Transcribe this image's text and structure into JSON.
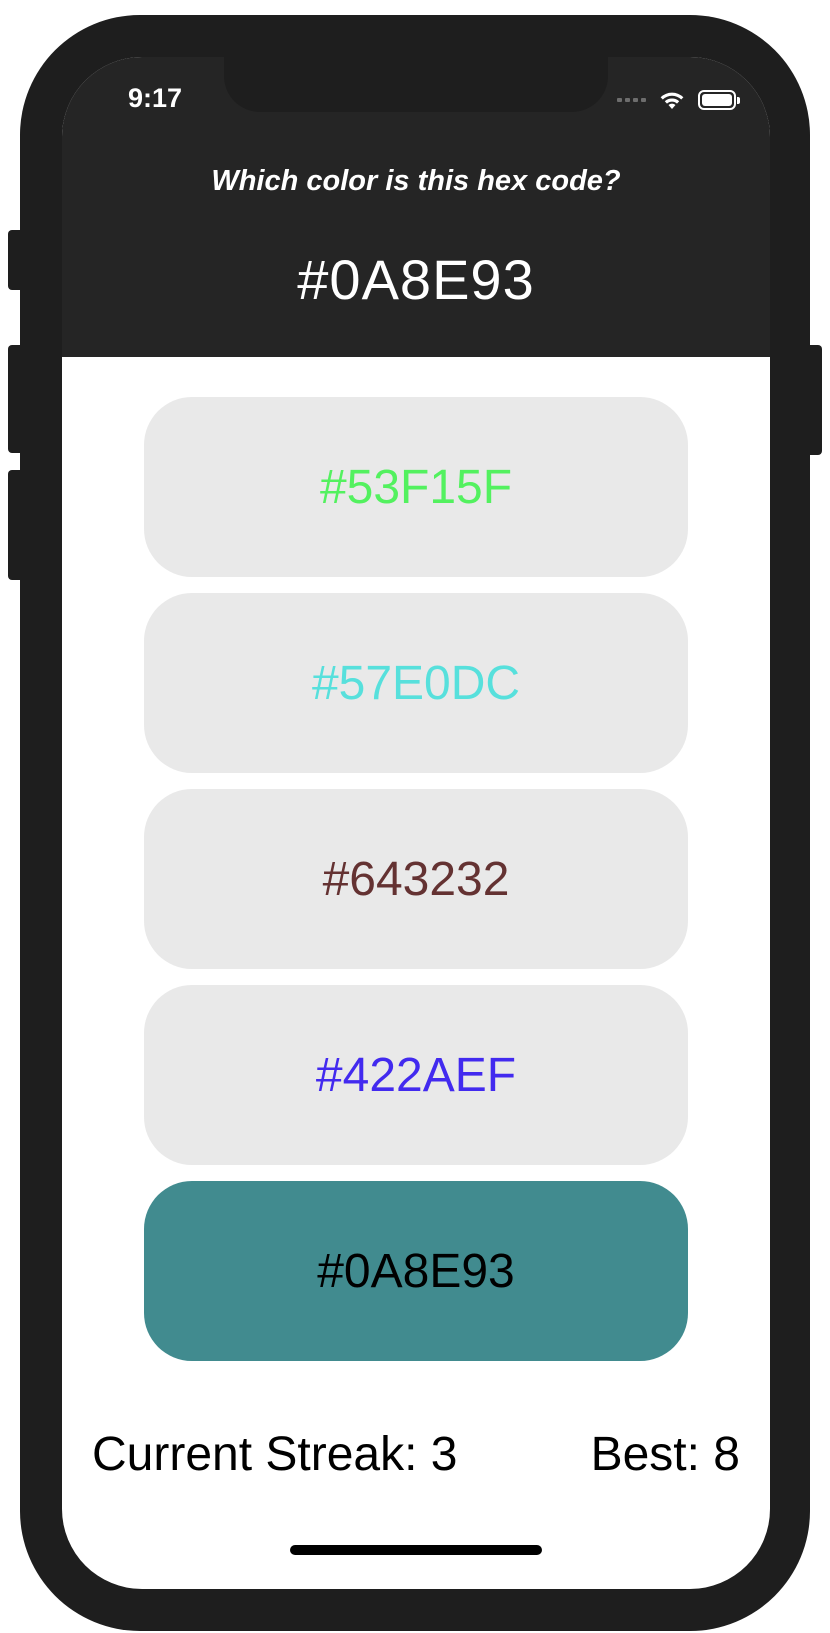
{
  "status_bar": {
    "time": "9:17"
  },
  "question": {
    "prompt": "Which color is this hex code?",
    "hex_code": "#0A8E93"
  },
  "options": [
    {
      "label": "#53F15F",
      "text_color": "#53F15F",
      "background": "#E9E9E9",
      "selected": false
    },
    {
      "label": "#57E0DC",
      "text_color": "#57E0DC",
      "background": "#E9E9E9",
      "selected": false
    },
    {
      "label": "#643232",
      "text_color": "#643232",
      "background": "#E9E9E9",
      "selected": false
    },
    {
      "label": "#422AEF",
      "text_color": "#422AEF",
      "background": "#E9E9E9",
      "selected": false
    },
    {
      "label": "#0A8E93",
      "text_color": "#000000",
      "background": "#418B8F",
      "selected": true
    }
  ],
  "stats": {
    "current_streak": "Current Streak: 3",
    "best": "Best: 8"
  },
  "colors": {
    "header_background": "#252525",
    "device_frame": "#1E1E1E",
    "option_default_background": "#E9E9E9",
    "correct_answer_background": "#418B8F"
  }
}
